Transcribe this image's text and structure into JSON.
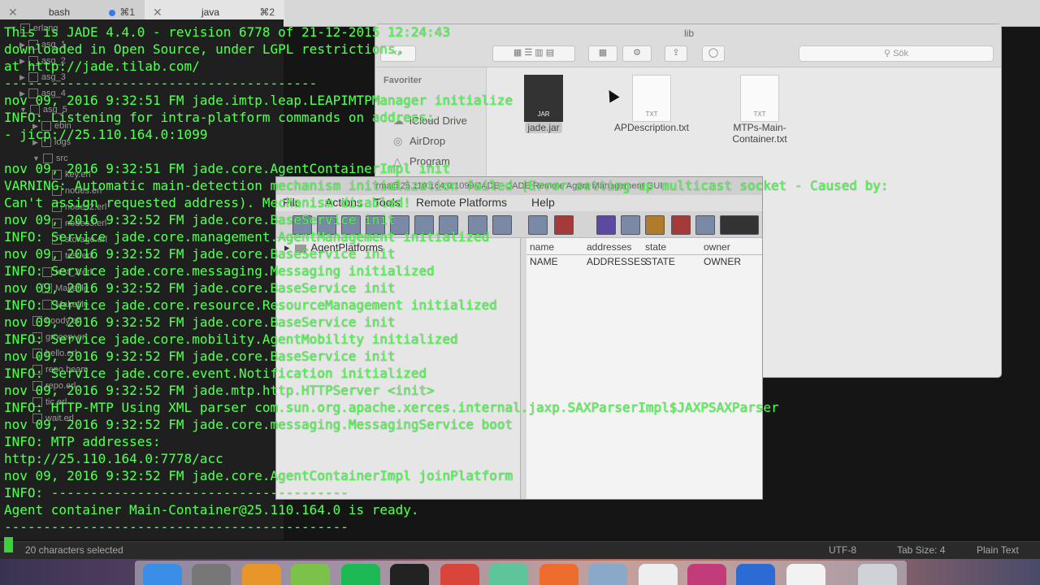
{
  "tabs": [
    {
      "title": "bash",
      "shortcut": "⌘1",
      "modified": true
    },
    {
      "title": "java",
      "shortcut": "⌘2"
    }
  ],
  "sidebar": {
    "items": [
      "erlang",
      "asg_1",
      "asg_2",
      "asg_3",
      "asg_4",
      "asg_5",
      "ebin",
      "logs",
      "src",
      "key.erl",
      "nodes.erl",
      "nodes2.erl",
      "nodes3.erl",
      "storage.erl",
      "test.erl",
      "test_2.erl",
      "Makefile",
      "Makefile",
      "hoody.erl",
      "grocery.erl",
      "hello.erl",
      "repo.beam",
      "repo.erl",
      "tic.erl",
      "wait.erl"
    ]
  },
  "finder": {
    "title": "lib",
    "search_placeholder": "Sök",
    "sidebar_header": "Favoriter",
    "sidebar_items": [
      "iCloud Drive",
      "AirDrop",
      "Program"
    ],
    "files": [
      {
        "name": "jade.jar",
        "type": "JAR",
        "selected": true
      },
      {
        "name": "APDescription.txt",
        "type": "TXT"
      },
      {
        "name": "MTPs-Main-Container.txt",
        "type": "TXT"
      }
    ]
  },
  "rma": {
    "title": "rma@25.110.164.0:1099/JADE - JADE Remote Agent Management GUI",
    "menu": [
      "File",
      "Actions",
      "Tools",
      "Remote Platforms",
      "Help"
    ],
    "tree_root": "AgentPlatforms",
    "columns": [
      "name",
      "addresses",
      "state",
      "owner"
    ],
    "row": [
      "NAME",
      "ADDRESSES",
      "STATE",
      "OWNER"
    ]
  },
  "terminal": {
    "lines": [
      "This is JADE 4.4.0 - revision 6778 of 21-12-2015 12:24:43",
      "downloaded in Open Source, under LGPL restrictions,",
      "at http://jade.tilab.com/",
      "----------------------------------------",
      "nov 09, 2016 9:32:51 FM jade.imtp.leap.LEAPIMTPManager initialize",
      "INFO: Listening for intra-platform commands on address:",
      "- jicp://25.110.164.0:1099",
      "",
      "nov 09, 2016 9:32:51 FM jade.core.AgentContainerImpl init",
      "VARNING: Automatic main-detection mechanism initialization failed (Error setting up multicast socket - Caused by:",
      "Can't assign requested address). Mechanism disabled!",
      "nov 09, 2016 9:32:52 FM jade.core.BaseService init",
      "INFO: Service jade.core.management.AgentManagement initialized",
      "nov 09, 2016 9:32:52 FM jade.core.BaseService init",
      "INFO: Service jade.core.messaging.Messaging initialized",
      "nov 09, 2016 9:32:52 FM jade.core.BaseService init",
      "INFO: Service jade.core.resource.ResourceManagement initialized",
      "nov 09, 2016 9:32:52 FM jade.core.BaseService init",
      "INFO: Service jade.core.mobility.AgentMobility initialized",
      "nov 09, 2016 9:32:52 FM jade.core.BaseService init",
      "INFO: Service jade.core.event.Notification initialized",
      "nov 09, 2016 9:32:52 FM jade.mtp.http.HTTPServer <init>",
      "INFO: HTTP-MTP Using XML parser com.sun.org.apache.xerces.internal.jaxp.SAXParserImpl$JAXPSAXParser",
      "nov 09, 2016 9:32:52 FM jade.core.messaging.MessagingService boot",
      "INFO: MTP addresses:",
      "http://25.110.164.0:7778/acc",
      "nov 09, 2016 9:32:52 FM jade.core.AgentContainerImpl joinPlatform",
      "INFO: --------------------------------------",
      "Agent container Main-Container@25.110.164.0 is ready.",
      "--------------------------------------------"
    ]
  },
  "statusbar": {
    "selection": "20 characters selected",
    "encoding": "UTF-8",
    "tab_size": "Tab Size: 4",
    "syntax": "Plain Text"
  },
  "dock": {
    "icons": [
      "finder-icon",
      "system-preferences-icon",
      "sublime-text-icon",
      "android-studio-icon",
      "spotify-icon",
      "terminal-icon",
      "chrome-icon",
      "atom-icon",
      "postman-icon",
      "preview-icon",
      "textedit-icon",
      "intellij-icon",
      "safari-icon",
      "java-icon",
      "trash-icon"
    ]
  }
}
